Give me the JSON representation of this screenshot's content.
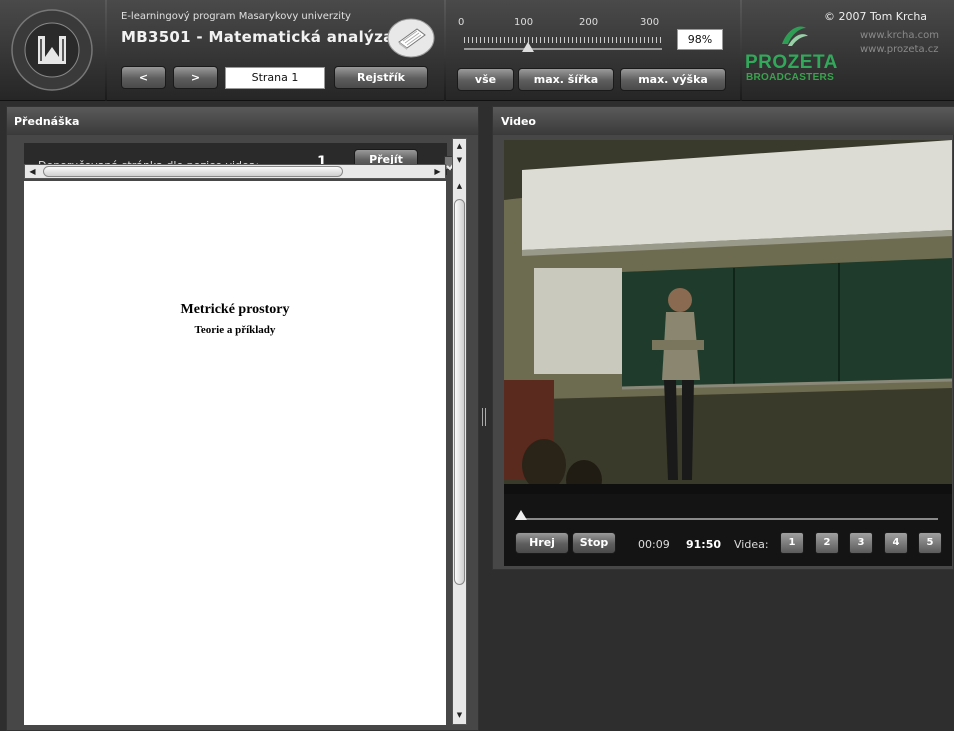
{
  "header": {
    "program_line": "E-learningový program Masarykovy univerzity",
    "course_title": "MB3501 - Matematická analýza 3",
    "prev_label": "<",
    "next_label": ">",
    "page_field_value": "Strana 1",
    "index_label": "Rejstřík",
    "logo_text": "UNIVERSITAS MASARYKIANA BRUNENSIS"
  },
  "zoom": {
    "ticks": [
      "0",
      "100",
      "200",
      "300"
    ],
    "value": "98%",
    "level": 0.33,
    "buttons": {
      "all": "vše",
      "max_width": "max. šířka",
      "max_height": "max. výška"
    }
  },
  "branding": {
    "prozeta": "PROZETA",
    "broadcasters": "BROADCASTERS",
    "copyright": "© 2007 Tom Krcha",
    "url1": "www.krcha.com",
    "url2": "www.prozeta.cz",
    "accent": "#32a85a"
  },
  "lecture": {
    "panel_title": "Přednáška",
    "recommend_text": "Doporučovaná stránka dle pozice videa:",
    "recommend_page": "1",
    "go_label": "Přejít",
    "doc_title": "Metrické prostory",
    "doc_subtitle": "Teorie a příklady"
  },
  "video": {
    "panel_title": "Video",
    "play_label": "Hrej",
    "stop_label": "Stop",
    "current_time": "00:09",
    "total_time": "91:50",
    "videos_label": "Videa:",
    "video_buttons": [
      "1",
      "2",
      "3",
      "4",
      "5"
    ],
    "progress": 0.002
  }
}
